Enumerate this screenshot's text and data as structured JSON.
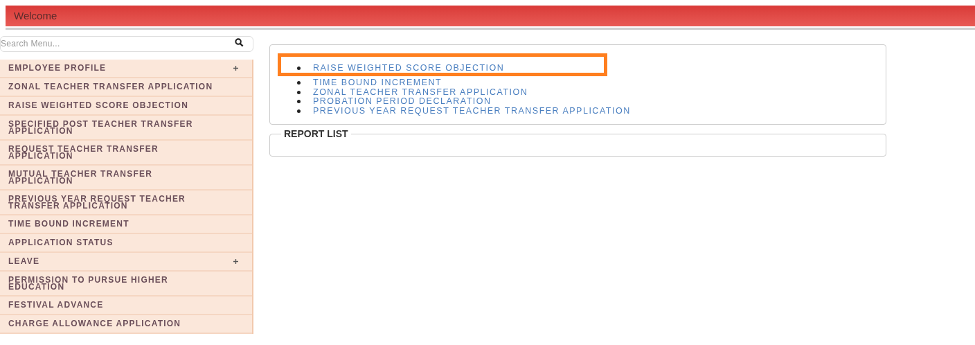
{
  "header": {
    "title": "Welcome"
  },
  "search": {
    "placeholder": "Search Menu..."
  },
  "menu": [
    {
      "label": "EMPLOYEE PROFILE",
      "submenu": true
    },
    {
      "label": "ZONAL TEACHER TRANSFER APPLICATION",
      "submenu": false
    },
    {
      "label": "RAISE WEIGHTED SCORE OBJECTION",
      "submenu": false
    },
    {
      "label": "SPECIFIED POST TEACHER TRANSFER APPLICATION",
      "submenu": false
    },
    {
      "label": "REQUEST TEACHER TRANSFER APPLICATION",
      "submenu": false
    },
    {
      "label": "MUTUAL TEACHER TRANSFER APPLICATION",
      "submenu": false
    },
    {
      "label": "PREVIOUS YEAR REQUEST TEACHER TRANSFER APPLICATION",
      "submenu": false
    },
    {
      "label": "TIME BOUND INCREMENT",
      "submenu": false
    },
    {
      "label": "APPLICATION STATUS",
      "submenu": false
    },
    {
      "label": "LEAVE",
      "submenu": true
    },
    {
      "label": "PERMISSION TO PURSUE HIGHER EDUCATION",
      "submenu": false
    },
    {
      "label": "FESTIVAL ADVANCE",
      "submenu": false
    },
    {
      "label": "CHARGE ALLOWANCE APPLICATION",
      "submenu": false
    }
  ],
  "quick_links": [
    {
      "label": "RAISE WEIGHTED SCORE OBJECTION",
      "highlighted": true
    },
    {
      "label": "TIME BOUND INCREMENT",
      "highlighted": false
    },
    {
      "label": "ZONAL TEACHER TRANSFER APPLICATION",
      "highlighted": false
    },
    {
      "label": "PROBATION PERIOD DECLARATION",
      "highlighted": false
    },
    {
      "label": "PREVIOUS YEAR REQUEST TEACHER TRANSFER APPLICATION",
      "highlighted": false
    }
  ],
  "report_list": {
    "title": "REPORT LIST"
  }
}
